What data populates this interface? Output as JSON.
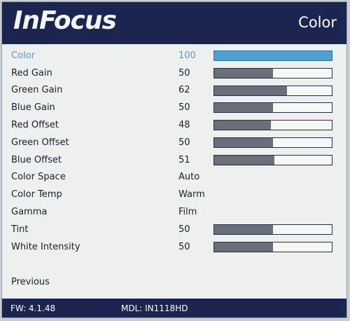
{
  "header": {
    "logo": "InFocus",
    "title": "Color"
  },
  "menu": [
    {
      "label": "Color",
      "value": "100",
      "level": 100,
      "selected": true
    },
    {
      "label": "Red Gain",
      "value": "50",
      "level": 50
    },
    {
      "label": "Green Gain",
      "value": "62",
      "level": 62
    },
    {
      "label": "Blue Gain",
      "value": "50",
      "level": 50
    },
    {
      "label": "Red Offset",
      "value": "48",
      "level": 48
    },
    {
      "label": "Green Offset",
      "value": "50",
      "level": 50
    },
    {
      "label": "Blue Offset",
      "value": "51",
      "level": 51
    },
    {
      "label": "Color Space",
      "value": "Auto"
    },
    {
      "label": "Color Temp",
      "value": "Warm"
    },
    {
      "label": "Gamma",
      "value": "Film"
    },
    {
      "label": "Tint",
      "value": "50",
      "level": 50
    },
    {
      "label": "White Intensity",
      "value": "50",
      "level": 50
    }
  ],
  "previous": "Previous",
  "footer": {
    "fw": "FW: 4.1.48",
    "mdl": "MDL: IN1118HD"
  }
}
